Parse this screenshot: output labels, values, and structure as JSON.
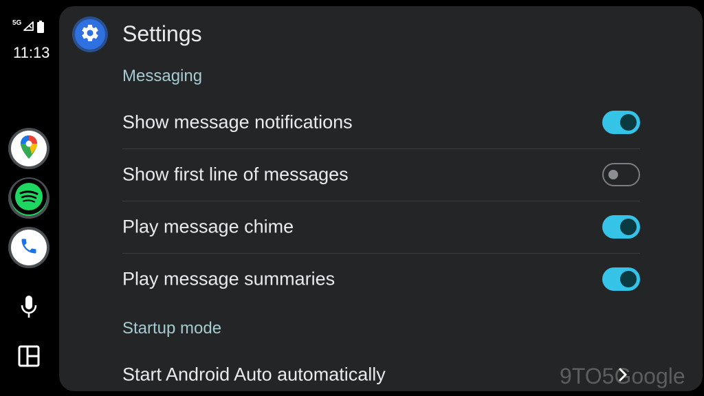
{
  "status_bar": {
    "network": "5G",
    "time": "11:13",
    "signal_icon": "signal-icon",
    "battery_icon": "battery-icon"
  },
  "rail": {
    "apps": [
      {
        "name": "Google Maps",
        "icon": "maps-icon"
      },
      {
        "name": "Spotify",
        "icon": "spotify-icon",
        "color": "#1ed760"
      },
      {
        "name": "Phone",
        "icon": "phone-icon",
        "color": "#1a73e8"
      }
    ],
    "mic_icon": "mic-icon",
    "dashboard_icon": "dashboard-icon"
  },
  "header": {
    "title": "Settings",
    "icon": "gear-icon"
  },
  "sections": [
    {
      "title": "Messaging",
      "items": [
        {
          "label": "Show message notifications",
          "toggle": true
        },
        {
          "label": "Show first line of messages",
          "toggle": false
        },
        {
          "label": "Play message chime",
          "toggle": true
        },
        {
          "label": "Play message summaries",
          "toggle": true
        }
      ]
    },
    {
      "title": "Startup mode",
      "items": [
        {
          "label": "Start Android Auto automatically",
          "icon": "chevron-right-icon"
        }
      ]
    }
  ],
  "watermark": "9TO5Google",
  "colors": {
    "accent": "#35c3e8",
    "panel": "#232526",
    "section_header": "#a6cbd2"
  }
}
